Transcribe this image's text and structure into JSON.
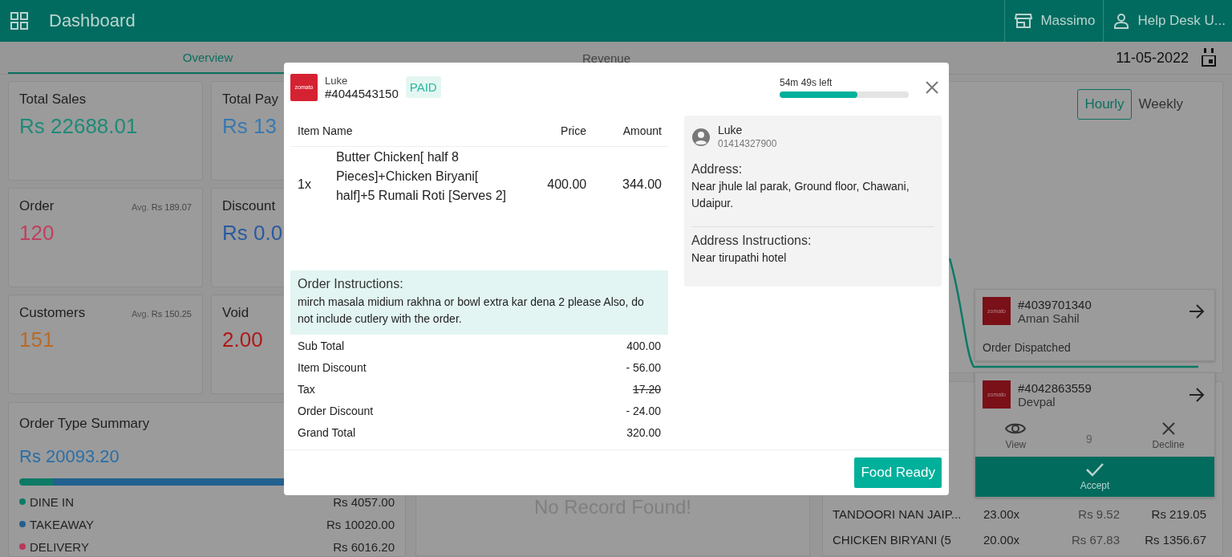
{
  "header": {
    "title": "Dashboard",
    "store": "Massimo",
    "user": "Help Desk U..."
  },
  "tabs": [
    {
      "label": "Overview",
      "selected": true
    },
    {
      "label": "Revenue",
      "selected": false
    }
  ],
  "date": "11-05-2022",
  "stat_cards": [
    {
      "title": "Total Sales",
      "value": "Rs 22688.01",
      "color": "#1f8a78"
    },
    {
      "title": "Total Pay",
      "value": "Rs 13",
      "color": "#3a78b0"
    },
    {
      "title": "Order",
      "value": "120",
      "avg": "Avg. **Rs 189.07**",
      "color": "#c04060"
    },
    {
      "title": "Discount",
      "value": "Rs 0.0",
      "color": "#2b5aa0"
    },
    {
      "title": "Customers",
      "value": "151",
      "avg": "Avg. **Rs 150.25**",
      "color": "#b86a28"
    },
    {
      "title": "Void",
      "value": "2.00",
      "color": "#b01818"
    }
  ],
  "order_type_summary": {
    "title": "Order Type Summary",
    "total": "Rs 20093.20",
    "types": [
      {
        "label": "DINE IN",
        "amount": "Rs 4057.00",
        "color": "#0d7a66",
        "level": 0.09
      },
      {
        "label": "TAKEAWAY",
        "amount": "Rs 10020.00",
        "color": "#22608f",
        "level": 0.91
      },
      {
        "label": "DELIVERY",
        "amount": "Rs 6016.20",
        "color": "#b83a58"
      }
    ]
  },
  "chart_panel": {
    "periods": [
      {
        "label": "Hourly",
        "selected": true
      },
      {
        "label": "Weekly",
        "selected": false
      }
    ]
  },
  "empty_panel": {
    "message": "No Record Found!"
  },
  "items_table": {
    "rows": [
      {
        "name": "TANDOORI NAN JAIP...",
        "qty": "23.00x",
        "price": "Rs 9.52",
        "amount": "Rs 219.05"
      },
      {
        "name": "CHICKEN BIRYANI (5",
        "qty": "20.00x",
        "price": "Rs 67.83",
        "amount": "Rs 1356.67"
      }
    ]
  },
  "notifications": [
    {
      "kind": "dispatched",
      "logo_text": "zomato",
      "order": "#4039701340",
      "customer": "Aman Sahil",
      "status": "Order Dispatched"
    },
    {
      "kind": "pending",
      "logo_text": "zomato",
      "order": "#4042863559",
      "customer": "Devpal",
      "view": "View",
      "count": "9",
      "decline": "Decline",
      "accept": "Accept"
    }
  ],
  "modal": {
    "logo_text": "zomato",
    "customer": "Luke",
    "order": "#4044543150",
    "payment": "PAID",
    "timer": {
      "text": "54m 49s left",
      "level": 0.6
    },
    "columns": [
      "Item Name",
      "Price",
      "Amount"
    ],
    "items": [
      {
        "qty": "1x",
        "name": "Butter Chicken[ half 8 Pieces]+Chicken Biryani[ half]+5 Rumali Roti [Serves 2]",
        "price": "400.00",
        "amount": "344.00"
      }
    ],
    "instructions": {
      "title": "Order Instructions:",
      "text": "mirch masala midium rakhna or bowl extra kar dena 2 please Also, do not include cutlery with the order."
    },
    "totals": [
      {
        "label": "Sub Total",
        "value": "400.00",
        "struck": false
      },
      {
        "label": "Item Discount",
        "value": "- 56.00",
        "struck": false
      },
      {
        "label": "Tax",
        "value": "17.20",
        "struck": true
      },
      {
        "label": "Order Discount",
        "value": "- 24.00",
        "struck": false
      },
      {
        "label": "Grand Total",
        "value": "320.00",
        "struck": false
      }
    ],
    "customer_card": {
      "name": "Luke",
      "phone": "01414327900",
      "address_title": "Address:",
      "address": "Near jhule lal parak, Ground floor, Chawani, Udaipur.",
      "instructions_title": "Address Instructions:",
      "instructions": "Near tirupathi hotel"
    },
    "action": "Food Ready"
  }
}
